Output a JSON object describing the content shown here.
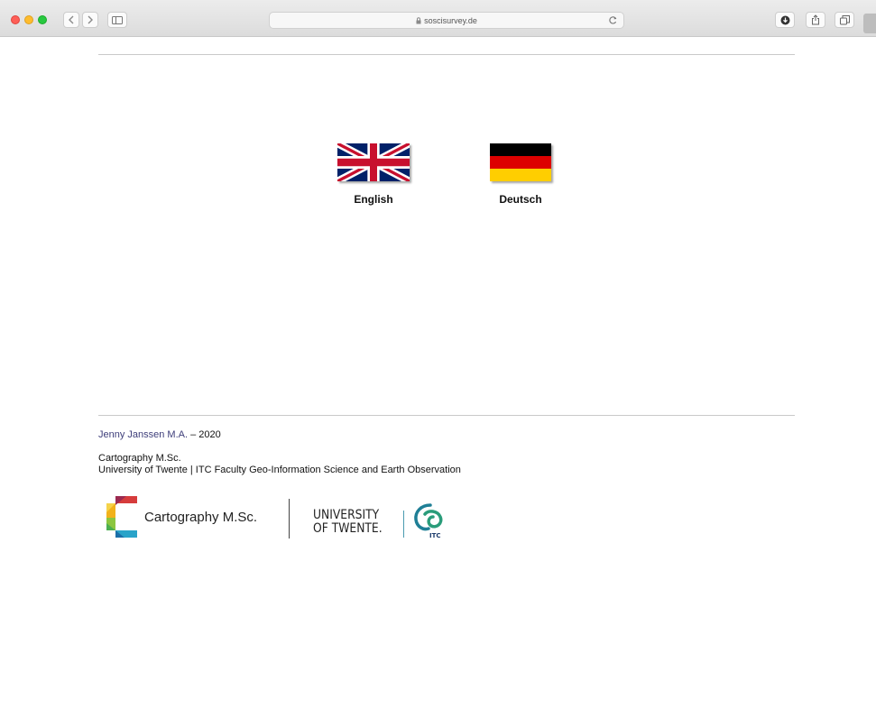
{
  "browser": {
    "url": "soscisurvey.de"
  },
  "languages": [
    {
      "label": "English"
    },
    {
      "label": "Deutsch"
    }
  ],
  "footer": {
    "author": "Jenny Janssen M.A.",
    "year_suffix": " – 2020",
    "program": "Cartography M.Sc.",
    "institution": "University of Twente | ITC Faculty Geo-Information Science and Earth Observation"
  },
  "logos": {
    "cartography_text": "Cartography M.Sc.",
    "university_line1": "UNIVERSITY",
    "university_line2": "OF TWENTE.",
    "itc_text": "ITC"
  },
  "colors": {
    "author_link": "#3e3e7a",
    "flag_de_black": "#000000",
    "flag_de_red": "#dd0000",
    "flag_de_gold": "#ffce00",
    "flag_uk_blue": "#012169",
    "flag_uk_red": "#c8102e",
    "itc_teal": "#1f7f96"
  },
  "icons": [
    "back-icon",
    "forward-icon",
    "sidebar-icon",
    "lock-icon",
    "reload-icon",
    "download-icon",
    "share-icon",
    "tabs-icon"
  ]
}
